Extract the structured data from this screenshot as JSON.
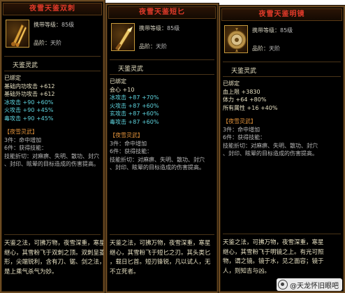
{
  "panels": [
    {
      "title": "夜雪天鉴双刺",
      "level_label": "携带等级：",
      "level_value": "85级",
      "grade_label": "品阶：",
      "grade_value": "天阶",
      "subtitle": "天鉴灵武",
      "bound": "已绑定",
      "stats": [
        {
          "text": "基础内功攻击 +612",
          "color": "white"
        },
        {
          "text": "基础外功攻击 +612",
          "color": "white"
        },
        {
          "text": "冰攻击 +90 +60%",
          "color": "cyan"
        },
        {
          "text": "火攻击 +90 +45%",
          "color": "cyan"
        },
        {
          "text": "毒攻击 +90 +45%",
          "color": "cyan"
        }
      ],
      "set_name": "【夜雪灵武】",
      "set_lines": [
        {
          "text": "3件：命中增加",
          "color": "gray"
        },
        {
          "text": "6件：获得技能：",
          "color": "gray"
        },
        {
          "text": "技能折切：对麻痹、失明、散功、封穴",
          "color": "gray"
        },
        {
          "text": "、封印、眩晕的目标造成的伤害提高。",
          "color": "gray"
        }
      ],
      "flavor": [
        "天鉴之法，可拂万物，夜雪深重，寒星",
        "继心，其雪粉飞于双刺之顶。双刺呈菱",
        "形，尖端锐利，含有刀、锯、剑之法，",
        "是上乘气杀气为妙。"
      ]
    },
    {
      "title": "夜雪天鉴短匕",
      "level_label": "携带等级：",
      "level_value": "85级",
      "grade_label": "品阶：",
      "grade_value": "天阶",
      "subtitle": "天鉴灵武",
      "bound": "已绑定",
      "stats": [
        {
          "text": "会心 +10",
          "color": "white"
        },
        {
          "text": "冰攻击 +87 +70%",
          "color": "cyan"
        },
        {
          "text": "火攻击 +87 +60%",
          "color": "cyan"
        },
        {
          "text": "玄攻击 +87 +60%",
          "color": "cyan"
        },
        {
          "text": "毒攻击 +87 +60%",
          "color": "cyan"
        }
      ],
      "set_name": "【夜雪灵武】",
      "set_lines": [
        {
          "text": "3件：命中增加",
          "color": "gray"
        },
        {
          "text": "6件：获得技能：",
          "color": "gray"
        },
        {
          "text": "技能折切：对麻痹、失明、散功、封穴",
          "color": "gray"
        },
        {
          "text": "、封印、眩晕的目标造成的伤害提高。",
          "color": "gray"
        }
      ],
      "flavor": [
        "天鉴之法，可拂万物，夜雪深重，寒星",
        "继心，其雪粉飞于短匕之刃。其头类匕",
        "，载日匕首。短刃锋锐，凡以试人，无",
        "不立死者。"
      ]
    },
    {
      "title": "夜雪天鉴明镜",
      "level_label": "携带等级：",
      "level_value": "85级",
      "grade_label": "品阶：",
      "grade_value": "天阶",
      "subtitle": "天鉴灵武",
      "bound": "已绑定",
      "stats": [
        {
          "text": "血上限 +3830",
          "color": "white"
        },
        {
          "text": "体力 +64 +80%",
          "color": "white"
        },
        {
          "text": "所有属性 +16 +40%",
          "color": "white"
        }
      ],
      "set_name": "【夜雪灵武】",
      "set_lines": [
        {
          "text": "3件：命中增加",
          "color": "gray"
        },
        {
          "text": "6件：获得技能：",
          "color": "gray"
        },
        {
          "text": "技能折切：对麻痹、失明、散功、封穴",
          "color": "gray"
        },
        {
          "text": "、封印、眩晕的目标造成的伤害提高。",
          "color": "gray"
        }
      ],
      "flavor": [
        "天鉴之法，可拂万物，夜雪深重，寒星",
        "继心，其雪粉飞于明镜之上。有光可照",
        "物，谓之镜。镜于水，见之面容；镜于",
        "人，则知吉与凶。"
      ]
    }
  ],
  "watermark": "@天龙怀旧眼吧",
  "colors": {
    "title": "#e03a2a",
    "cyan": "#5fd6e0",
    "orange": "#e0913a",
    "border": "#6b4a22"
  },
  "icons": [
    "twin-daggers-icon",
    "short-dagger-icon",
    "bronze-mirror-icon",
    "paw-icon"
  ]
}
